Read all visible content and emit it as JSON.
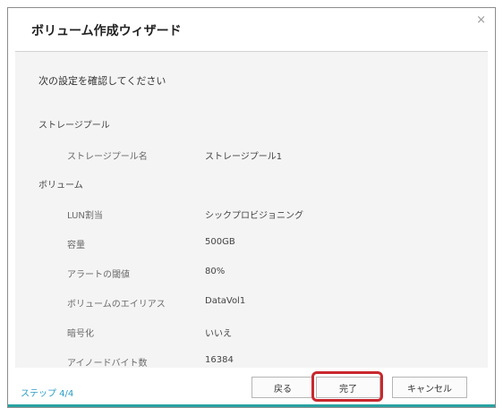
{
  "dialog": {
    "title": "ボリューム作成ウィザード",
    "close_symbol": "×"
  },
  "content": {
    "prompt": "次の設定を確認してください",
    "storage_pool": {
      "heading": "ストレージプール",
      "name_label": "ストレージプール名",
      "name_value": "ストレージプール1"
    },
    "volume": {
      "heading": "ボリューム",
      "rows": [
        {
          "label": "LUN割当",
          "value": "シックプロビジョニング"
        },
        {
          "label": "容量",
          "value": "500GB"
        },
        {
          "label": "アラートの閾値",
          "value": "80%"
        },
        {
          "label": "ボリュームのエイリアス",
          "value": "DataVol1"
        },
        {
          "label": "暗号化",
          "value": "いいえ"
        },
        {
          "label": "アイノードバイト数",
          "value": "16384"
        }
      ]
    }
  },
  "footer": {
    "step": "ステップ 4/4",
    "back_label": "戻る",
    "finish_label": "完了",
    "cancel_label": "キャンセル"
  },
  "colors": {
    "step_text": "#2b9bc6",
    "highlight": "#c8282e",
    "accent_bar": "#29a3a3"
  }
}
